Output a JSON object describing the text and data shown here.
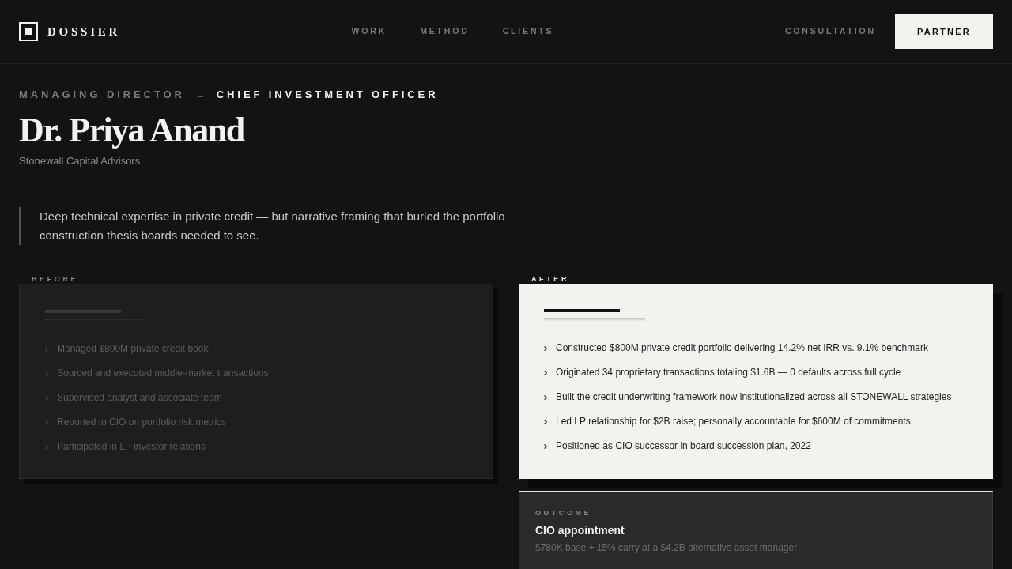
{
  "header": {
    "logo": "DOSSIER",
    "nav": [
      "WORK",
      "METHOD",
      "CLIENTS"
    ],
    "link": "CONSULTATION",
    "button": "PARTNER"
  },
  "profile": {
    "from_role": "MANAGING DIRECTOR",
    "separator": "→",
    "to_role": "CHIEF INVESTMENT OFFICER",
    "name": "Dr. Priya Anand",
    "company": "Stonewall Capital Advisors"
  },
  "quote": "Deep technical expertise in private credit — but narrative framing that buried the portfolio construction thesis boards needed to see.",
  "panels": [
    {
      "kind": "before",
      "label": "BEFORE",
      "items": [
        "Managed $800M private credit book",
        "Sourced and executed middle-market transactions",
        "Supervised analyst and associate team",
        "Reported to CIO on portfolio risk metrics",
        "Participated in LP investor relations"
      ]
    },
    {
      "kind": "after",
      "label": "AFTER",
      "items": [
        "Constructed $800M private credit portfolio delivering 14.2% net IRR vs. 9.1% benchmark",
        "Originated 34 proprietary transactions totaling $1.6B — 0 defaults across full cycle",
        "Built the credit underwriting framework now institutionalized across all STONEWALL strategies",
        "Led LP relationship for $2B raise; personally accountable for $600M of commitments",
        "Positioned as CIO successor in board succession plan, 2022"
      ]
    }
  ],
  "outcome": {
    "label": "OUTCOME",
    "title": "CIO appointment",
    "detail": "$780K base + 15% carry at a $4.2B alternative asset manager"
  }
}
